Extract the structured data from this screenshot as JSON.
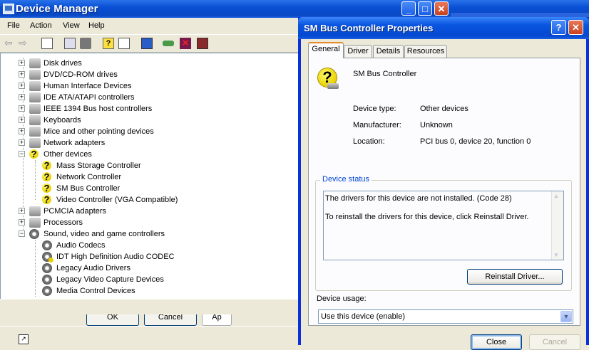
{
  "window": {
    "title": "Device Manager"
  },
  "menu": [
    "File",
    "Action",
    "View",
    "Help"
  ],
  "tree": {
    "items": [
      {
        "label": "Disk drives",
        "icon": "disk-drive-icon",
        "expander": "+"
      },
      {
        "label": "DVD/CD-ROM drives",
        "icon": "dvd-drive-icon",
        "expander": "+"
      },
      {
        "label": "Human Interface Devices",
        "icon": "hid-icon",
        "expander": "+"
      },
      {
        "label": "IDE ATA/ATAPI controllers",
        "icon": "ide-controller-icon",
        "expander": "+"
      },
      {
        "label": "IEEE 1394 Bus host controllers",
        "icon": "ieee1394-icon",
        "expander": "+"
      },
      {
        "label": "Keyboards",
        "icon": "keyboard-icon",
        "expander": "+"
      },
      {
        "label": "Mice and other pointing devices",
        "icon": "mouse-icon",
        "expander": "+"
      },
      {
        "label": "Network adapters",
        "icon": "network-adapter-icon",
        "expander": "+"
      },
      {
        "label": "Other devices",
        "icon": "unknown-device-icon",
        "expander": "-"
      },
      {
        "label": "Mass Storage Controller",
        "icon": "unknown-device-icon",
        "child": true
      },
      {
        "label": "Network Controller",
        "icon": "unknown-device-icon",
        "child": true
      },
      {
        "label": "SM Bus Controller",
        "icon": "unknown-device-icon",
        "child": true
      },
      {
        "label": "Video Controller (VGA Compatible)",
        "icon": "unknown-device-icon",
        "child": true
      },
      {
        "label": "PCMCIA adapters",
        "icon": "pcmcia-icon",
        "expander": "+"
      },
      {
        "label": "Processors",
        "icon": "processor-icon",
        "expander": "+"
      },
      {
        "label": "Sound, video and game controllers",
        "icon": "sound-icon",
        "expander": "-"
      },
      {
        "label": "Audio Codecs",
        "icon": "sound-icon",
        "child": true
      },
      {
        "label": "IDT High Definition Audio CODEC",
        "icon": "sound-warning-icon",
        "child": true
      },
      {
        "label": "Legacy Audio Drivers",
        "icon": "sound-icon",
        "child": true
      },
      {
        "label": "Legacy Video Capture Devices",
        "icon": "sound-icon",
        "child": true
      },
      {
        "label": "Media Control Devices",
        "icon": "sound-icon",
        "child": true
      }
    ]
  },
  "background_buttons": {
    "ok": "OK",
    "cancel": "Cancel",
    "apply": "Ap"
  },
  "dialog": {
    "title": "SM Bus Controller Properties",
    "help_btn": "?",
    "close_btn": "✕",
    "tabs": [
      "General",
      "Driver",
      "Details",
      "Resources"
    ],
    "active_tab": "General",
    "device_name": "SM Bus Controller",
    "device_type_label": "Device type:",
    "device_type": "Other devices",
    "manufacturer_label": "Manufacturer:",
    "manufacturer": "Unknown",
    "location_label": "Location:",
    "location": "PCI bus 0, device 20, function 0",
    "status_group": "Device status",
    "status_line1": "The drivers for this device are not installed. (Code 28)",
    "status_line2": "To reinstall the drivers for this device, click Reinstall Driver.",
    "reinstall_btn": "Reinstall Driver...",
    "usage_label": "Device usage:",
    "usage_value": "Use this device (enable)",
    "close_label": "Close",
    "cancel_label": "Cancel"
  },
  "colors": {
    "title_blue": "#0a50d6",
    "tab_accent": "#e68b2c",
    "group_title": "#0046d5"
  }
}
